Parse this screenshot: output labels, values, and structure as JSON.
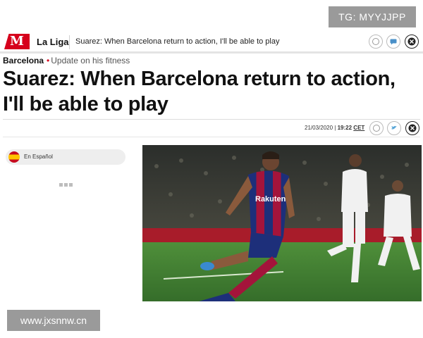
{
  "watermarks": {
    "top": "TG: MYYJJPP",
    "bottom": "www.jxsnnw.cn"
  },
  "nav": {
    "logo": "M",
    "section": "La Liga",
    "headline": "Suarez: When Barcelona return to action, I'll be able to play",
    "icons": [
      "whatsapp-icon",
      "comment-icon",
      "close-icon"
    ]
  },
  "breadcrumb": {
    "section": "Barcelona",
    "subsection": "Update on his fitness"
  },
  "article": {
    "title": "Suarez: When Barcelona return to action, I'll be able to play",
    "date": "21/03/2020",
    "time_sep": "|",
    "time": "19:22",
    "timezone": "CET"
  },
  "language": {
    "label": "En Español"
  },
  "photo": {
    "colors": {
      "pitch": "#3f7f33",
      "barca_blue": "#1d2f7a",
      "barca_red": "#a4143b",
      "crowd": "#3a3c38",
      "madrid_white": "#f1f1f1"
    }
  }
}
